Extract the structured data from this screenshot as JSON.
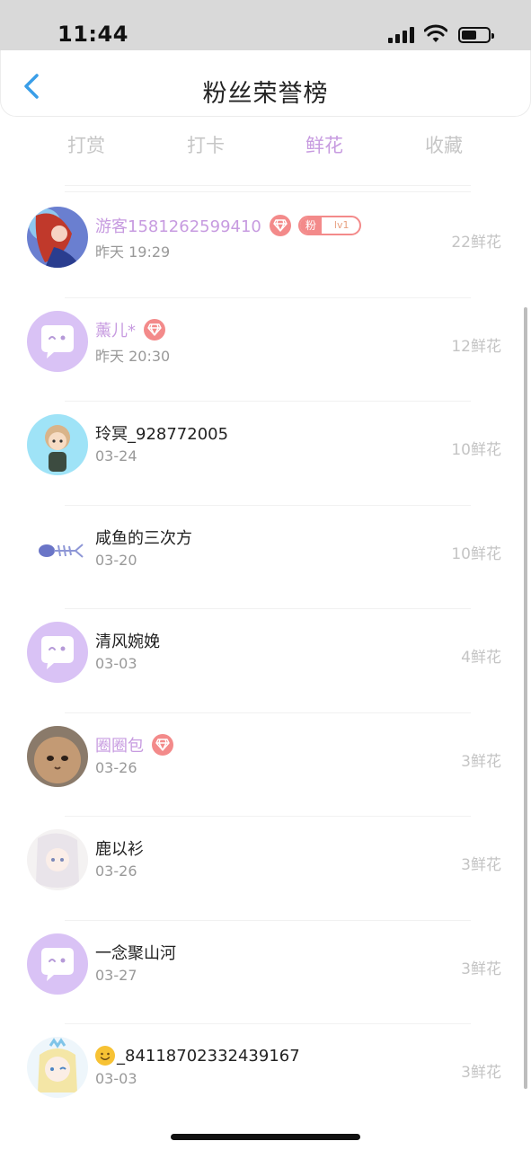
{
  "status_bar": {
    "time": "11:44"
  },
  "header": {
    "title": "粉丝荣誉榜"
  },
  "tabs": [
    {
      "label": "打赏",
      "active": false
    },
    {
      "label": "打卡",
      "active": false
    },
    {
      "label": "鲜花",
      "active": true
    },
    {
      "label": "收藏",
      "active": false
    }
  ],
  "badges": {
    "fan_tag": "粉",
    "fan_level": "lv1"
  },
  "colors": {
    "accent": "#c79be0",
    "gem": "#f38a8a",
    "default_avatar": "#d9c2f5"
  },
  "fans": [
    {
      "emoji": "",
      "name": "游客1581262599410",
      "time": "昨天 19:29",
      "count": "22鲜花",
      "vip": true,
      "gem": true,
      "fan_badge": true,
      "avatar": "mermaid-art"
    },
    {
      "emoji": "",
      "name": "薰儿*",
      "time": "昨天 20:30",
      "count": "12鲜花",
      "vip": true,
      "gem": true,
      "fan_badge": false,
      "avatar": "default-chat"
    },
    {
      "emoji": "",
      "name": "玲冥_928772005",
      "time": "03-24",
      "count": "10鲜花",
      "vip": false,
      "gem": false,
      "fan_badge": false,
      "avatar": "chibi-boy"
    },
    {
      "emoji": "",
      "name": "咸鱼的三次方",
      "time": "03-20",
      "count": "10鲜花",
      "vip": false,
      "gem": false,
      "fan_badge": false,
      "avatar": "fish-bone"
    },
    {
      "emoji": "",
      "name": "清风婉娩",
      "time": "03-03",
      "count": "4鲜花",
      "vip": false,
      "gem": false,
      "fan_badge": false,
      "avatar": "default-chat"
    },
    {
      "emoji": "",
      "name": "圈圈包",
      "time": "03-26",
      "count": "3鲜花",
      "vip": true,
      "gem": true,
      "fan_badge": false,
      "avatar": "cat-photo"
    },
    {
      "emoji": "",
      "name": "鹿以衫",
      "time": "03-26",
      "count": "3鲜花",
      "vip": false,
      "gem": false,
      "fan_badge": false,
      "avatar": "anime-girl"
    },
    {
      "emoji": "",
      "name": "一念聚山河",
      "time": "03-27",
      "count": "3鲜花",
      "vip": false,
      "gem": false,
      "fan_badge": false,
      "avatar": "default-chat"
    },
    {
      "emoji": "😊",
      "name": "_84118702332439167",
      "time": "03-03",
      "count": "3鲜花",
      "vip": false,
      "gem": false,
      "fan_badge": false,
      "avatar": "anime-crown"
    }
  ]
}
